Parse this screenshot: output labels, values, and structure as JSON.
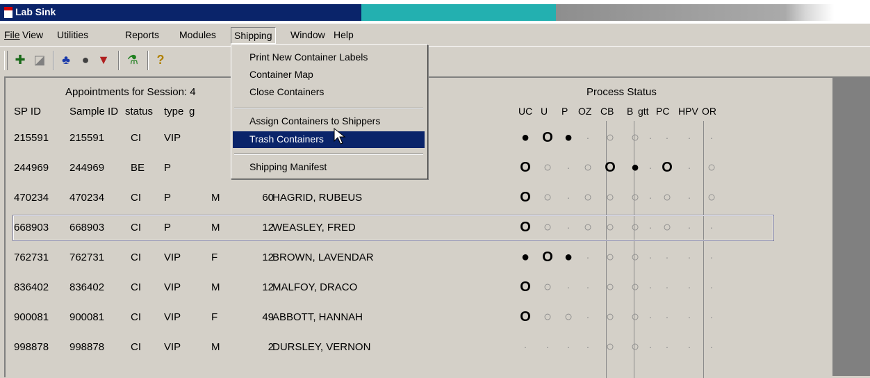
{
  "window": {
    "title": "Lab Sink"
  },
  "menubar": {
    "items": [
      "File",
      "View",
      "Utilities",
      "Reports",
      "Modules",
      "Shipping",
      "Window",
      "Help"
    ],
    "active": "Shipping"
  },
  "toolbar": {
    "buttons": [
      "new-icon",
      "open-icon",
      "people-icon",
      "stop-icon",
      "tag-icon",
      "flask-icon",
      "help-icon"
    ]
  },
  "shipping_menu": {
    "items": [
      {
        "label": "Print New Container Labels",
        "ul": "P"
      },
      {
        "label": "Container Map",
        "ul": "M"
      },
      {
        "label": "Close Containers",
        "ul": "C"
      },
      {
        "label": "Assign Containers to Shippers",
        "ul": "S"
      },
      {
        "label": "Trash Containers",
        "ul": "T",
        "highlighted": true
      },
      {
        "label": "Shipping Manifest",
        "ul": "M"
      }
    ]
  },
  "session": {
    "heading": "Appointments for Session: 4",
    "process_status": "Process Status",
    "columns": {
      "spid": "SP ID",
      "sampleid": "Sample ID",
      "status": "status",
      "type": "type",
      "g": "g"
    },
    "status_columns": [
      "UC",
      "U",
      "P",
      "OZ",
      "CB",
      "B",
      "gtt",
      "PC",
      "HPV",
      "OR"
    ]
  },
  "rows": [
    {
      "spid": "215591",
      "sampleid": "215591",
      "status": "CI",
      "type": "VIP",
      "gender": "",
      "age": "",
      "name": "",
      "marks": [
        "F",
        "O",
        "F",
        "d",
        "g",
        "g",
        "d",
        "d",
        "d",
        "d"
      ]
    },
    {
      "spid": "244969",
      "sampleid": "244969",
      "status": "BE",
      "type": "P",
      "gender": "",
      "age": "",
      "name": "",
      "marks": [
        "O",
        "g",
        "d",
        "g",
        "O",
        "F",
        "d",
        "O",
        "d",
        "g"
      ]
    },
    {
      "spid": "470234",
      "sampleid": "470234",
      "status": "CI",
      "type": "P",
      "gender": "M",
      "age": "60",
      "name": "HAGRID, RUBEUS",
      "marks": [
        "O",
        "g",
        "d",
        "g",
        "g",
        "g",
        "d",
        "g",
        "d",
        "g"
      ]
    },
    {
      "spid": "668903",
      "sampleid": "668903",
      "status": "CI",
      "type": "P",
      "gender": "M",
      "age": "12",
      "name": "WEASLEY, FRED",
      "marks": [
        "O",
        "g",
        "d",
        "g",
        "g",
        "g",
        "d",
        "g",
        "d",
        "d"
      ],
      "selected": true
    },
    {
      "spid": "762731",
      "sampleid": "762731",
      "status": "CI",
      "type": "VIP",
      "gender": "F",
      "age": "12",
      "name": "BROWN, LAVENDAR",
      "marks": [
        "F",
        "O",
        "F",
        "d",
        "g",
        "g",
        "d",
        "d",
        "d",
        "d"
      ]
    },
    {
      "spid": "836402",
      "sampleid": "836402",
      "status": "CI",
      "type": "VIP",
      "gender": "M",
      "age": "12",
      "name": "MALFOY, DRACO",
      "marks": [
        "O",
        "g",
        "d",
        "d",
        "g",
        "g",
        "d",
        "d",
        "d",
        "d"
      ]
    },
    {
      "spid": "900081",
      "sampleid": "900081",
      "status": "CI",
      "type": "VIP",
      "gender": "F",
      "age": "49",
      "name": "ABBOTT, HANNAH",
      "marks": [
        "O",
        "g",
        "g",
        "d",
        "g",
        "g",
        "d",
        "d",
        "d",
        "d"
      ]
    },
    {
      "spid": "998878",
      "sampleid": "998878",
      "status": "CI",
      "type": "VIP",
      "gender": "M",
      "age": "2",
      "name": "DURSLEY, VERNON",
      "marks": [
        "d",
        "d",
        "d",
        "d",
        "g",
        "g",
        "d",
        "d",
        "d",
        "d"
      ]
    }
  ]
}
